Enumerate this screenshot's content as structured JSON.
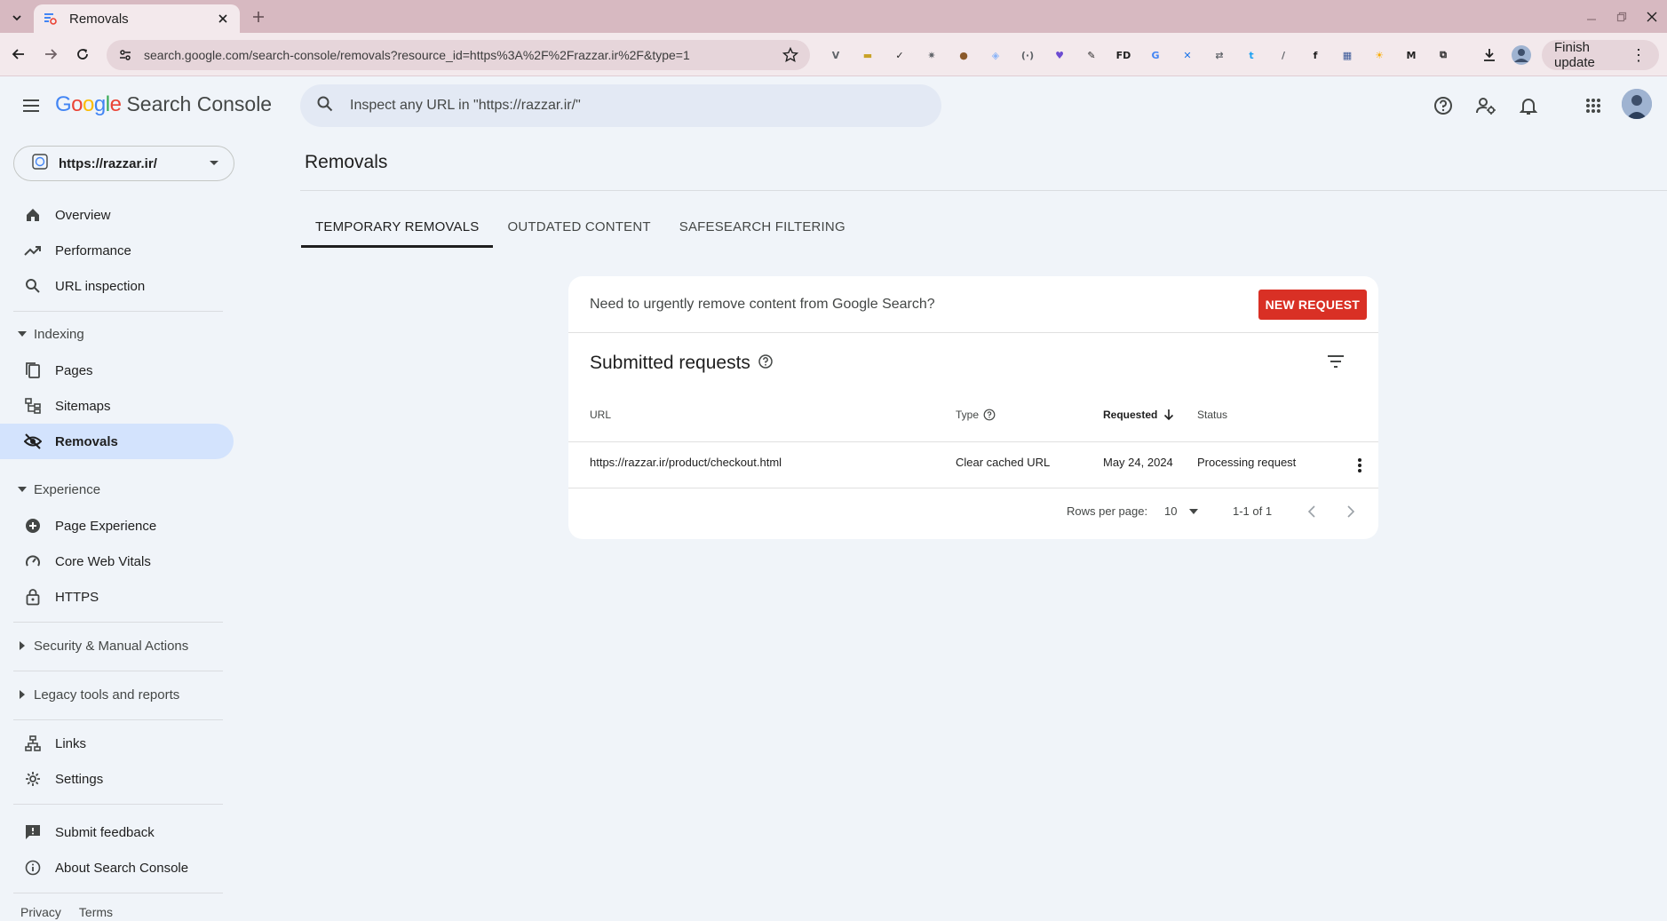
{
  "browser": {
    "tab_title": "Removals",
    "url": "search.google.com/search-console/removals?resource_id=https%3A%2F%2Frazzar.ir%2F&type=1",
    "finish_update_label": "Finish update",
    "extensions": [
      {
        "name": "vimium-icon",
        "text": "V",
        "color": "#5f6368"
      },
      {
        "name": "folder-ext-icon",
        "text": "▬",
        "color": "#c9a227"
      },
      {
        "name": "check-circle-ext-icon",
        "text": "✓",
        "color": "#1f1f1f"
      },
      {
        "name": "gear-ext-icon",
        "text": "✷",
        "color": "#5f6368"
      },
      {
        "name": "cookie-ext-icon",
        "text": "●",
        "color": "#8b5a2b"
      },
      {
        "name": "shield-ext-icon",
        "text": "◈",
        "color": "#8ab4f8"
      },
      {
        "name": "code-ext-icon",
        "text": "(·)",
        "color": "#5f6368"
      },
      {
        "name": "heart-ext-icon",
        "text": "♥",
        "color": "#6c4bd1"
      },
      {
        "name": "pen-ext-icon",
        "text": "✎",
        "color": "#1f1f1f"
      },
      {
        "name": "fd-ext-icon",
        "text": "FD",
        "color": "#1f1f1f"
      },
      {
        "name": "translate-ext-icon",
        "text": "G",
        "color": "#4285f4"
      },
      {
        "name": "shuffle-ext-icon",
        "text": "✕",
        "color": "#1a73e8"
      },
      {
        "name": "sync-ext-icon",
        "text": "⇄",
        "color": "#5f6368"
      },
      {
        "name": "t-ext-icon",
        "text": "t",
        "color": "#1da1f2"
      },
      {
        "name": "brush-ext-icon",
        "text": "/",
        "color": "#5f6368"
      },
      {
        "name": "f-ext-icon",
        "text": "f",
        "color": "#1f1f1f"
      },
      {
        "name": "grid-ext-icon",
        "text": "▦",
        "color": "#3b5998"
      },
      {
        "name": "sun-ext-icon",
        "text": "☀",
        "color": "#f9ab00"
      },
      {
        "name": "m-ext-icon",
        "text": "M",
        "color": "#1f1f1f"
      },
      {
        "name": "puzzle-ext-icon",
        "text": "⧉",
        "color": "#1f1f1f"
      }
    ]
  },
  "header": {
    "product_google": [
      "G",
      "o",
      "o",
      "g",
      "l",
      "e"
    ],
    "product_name": "Search Console",
    "search_placeholder": "Inspect any URL in \"https://razzar.ir/\""
  },
  "sidebar": {
    "property": "https://razzar.ir/",
    "items_top": [
      {
        "label": "Overview",
        "icon": "home-icon"
      },
      {
        "label": "Performance",
        "icon": "trending-up-icon"
      },
      {
        "label": "URL inspection",
        "icon": "search-icon"
      }
    ],
    "sections": {
      "indexing": "Indexing",
      "experience": "Experience",
      "security": "Security & Manual Actions",
      "legacy": "Legacy tools and reports"
    },
    "indexing_items": [
      {
        "label": "Pages",
        "icon": "pages-icon"
      },
      {
        "label": "Sitemaps",
        "icon": "sitemap-icon"
      },
      {
        "label": "Removals",
        "icon": "eye-off-icon"
      }
    ],
    "experience_items": [
      {
        "label": "Page Experience",
        "icon": "plus-circle-icon"
      },
      {
        "label": "Core Web Vitals",
        "icon": "speed-icon"
      },
      {
        "label": "HTTPS",
        "icon": "lock-icon"
      }
    ],
    "other_items": [
      {
        "label": "Links",
        "icon": "links-icon"
      },
      {
        "label": "Settings",
        "icon": "gear-icon"
      }
    ],
    "footer_items": [
      {
        "label": "Submit feedback",
        "icon": "feedback-icon"
      },
      {
        "label": "About Search Console",
        "icon": "info-icon"
      }
    ],
    "footer_links": [
      "Privacy",
      "Terms"
    ]
  },
  "main": {
    "title": "Removals",
    "tabs": [
      "TEMPORARY REMOVALS",
      "OUTDATED CONTENT",
      "SAFESEARCH FILTERING"
    ],
    "banner_text": "Need to urgently remove content from Google Search?",
    "new_request_label": "NEW REQUEST",
    "card_heading": "Submitted requests",
    "columns": {
      "url": "URL",
      "type": "Type",
      "requested": "Requested",
      "status": "Status"
    },
    "rows": [
      {
        "url": "https://razzar.ir/product/checkout.html",
        "type": "Clear cached URL",
        "requested": "May 24, 2024",
        "status": "Processing request"
      }
    ],
    "pagination": {
      "rows_per_page_label": "Rows per page:",
      "rows_per_page": "10",
      "range": "1-1 of 1"
    }
  },
  "colors": {
    "accent_red": "#d93025",
    "active_nav_bg": "#d3e3fd",
    "page_bg": "#f0f4f9",
    "tabstrip": "#d7b9c1"
  }
}
